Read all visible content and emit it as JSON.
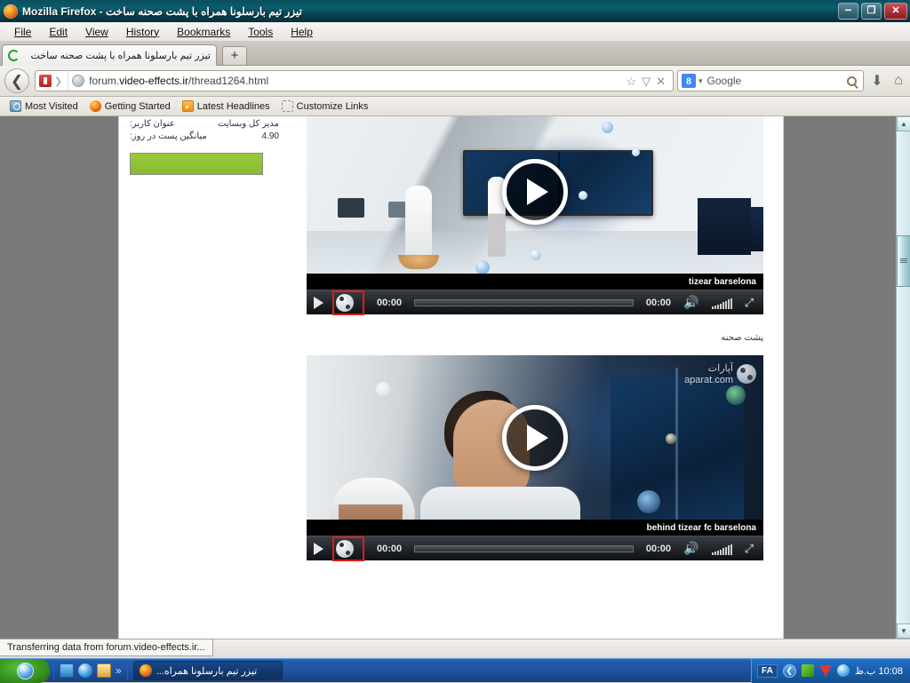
{
  "window": {
    "title": "تیزر تیم بارسلونا همراه با پشت صحنه ساخت - Mozilla Firefox",
    "minimize_label": "–",
    "restore_label": "❐",
    "close_label": "✕"
  },
  "menubar": {
    "items": [
      {
        "label": "File",
        "accel": "F"
      },
      {
        "label": "Edit",
        "accel": "E"
      },
      {
        "label": "View",
        "accel": "V"
      },
      {
        "label": "History",
        "accel": "s"
      },
      {
        "label": "Bookmarks",
        "accel": "B"
      },
      {
        "label": "Tools",
        "accel": "T"
      },
      {
        "label": "Help",
        "accel": "H"
      }
    ]
  },
  "tabs": {
    "active_title": "تیزر تیم بارسلونا همراه با پشت صحنه ساخت",
    "new_tab_label": "+"
  },
  "toolbar": {
    "back_label": "❮",
    "url_prefix": "forum.",
    "url_domain": "video-effects.ir",
    "url_path": "/thread1264.html",
    "url_full": "forum.video-effects.ir/thread1264.html",
    "bookmark_star": "☆",
    "dropmarker": "▽",
    "stop_label": "✕",
    "search_engine": "Google",
    "search_engine_badge": "8",
    "search_dropmarker": "▾",
    "download_label": "⬇",
    "home_label": "⌂"
  },
  "bookmarks_bar": {
    "items": [
      {
        "label": "Most Visited",
        "icon": "most-visited-icon"
      },
      {
        "label": "Getting Started",
        "icon": "firefox-icon"
      },
      {
        "label": "Latest Headlines",
        "icon": "rss-icon"
      },
      {
        "label": "Customize Links",
        "icon": "dashed-box-icon"
      }
    ]
  },
  "page": {
    "userinfo": [
      {
        "label": "عنوان کاربر:",
        "value": "مدیر کل وبسایت"
      },
      {
        "label": "میانگین پست در روز:",
        "value": "4.90"
      }
    ],
    "green_bar_color": "#9ac93a",
    "section_label": "پشت صحنه",
    "videos": [
      {
        "title": "tizear barselona",
        "current_time": "00:00",
        "total_time": "00:00",
        "play_label": "▶",
        "logo_name": "aparat-logo",
        "highlight_color": "#e01c1c",
        "watermark_fa": "",
        "watermark_en": ""
      },
      {
        "title": "behind tizear fc barselona",
        "current_time": "00:00",
        "total_time": "00:00",
        "play_label": "▶",
        "logo_name": "aparat-logo",
        "highlight_color": "#e01c1c",
        "watermark_fa": "آپارات",
        "watermark_en": "aparat.com"
      }
    ]
  },
  "scrollbar": {
    "up_label": "▲",
    "down_label": "▼"
  },
  "status": {
    "text": "Transferring data from forum.video-effects.ir..."
  },
  "taskbar": {
    "start_label": "",
    "quicklaunch_more": "»",
    "task_label": "تیزر تیم بارسلونا همراه...",
    "language": "FA",
    "tray_chevron": "❮",
    "clock": "10:08 ب.ظ"
  }
}
